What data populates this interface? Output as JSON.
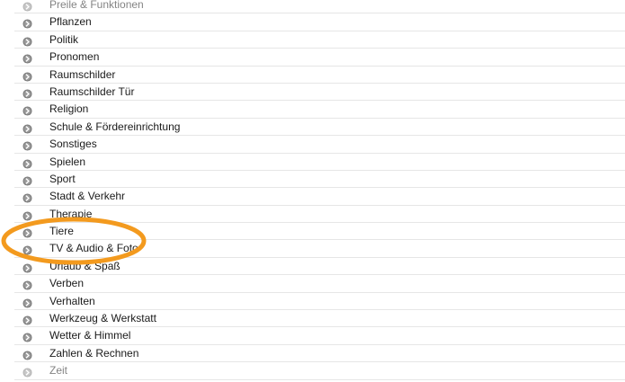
{
  "category_list": {
    "items": [
      {
        "label": "Preile & Funktionen"
      },
      {
        "label": "Pflanzen"
      },
      {
        "label": "Politik"
      },
      {
        "label": "Pronomen"
      },
      {
        "label": "Raumschilder"
      },
      {
        "label": "Raumschilder Tür"
      },
      {
        "label": "Religion"
      },
      {
        "label": "Schule & Fördereinrichtung"
      },
      {
        "label": "Sonstiges"
      },
      {
        "label": "Spielen"
      },
      {
        "label": "Sport"
      },
      {
        "label": "Stadt & Verkehr"
      },
      {
        "label": "Therapie"
      },
      {
        "label": "Tiere"
      },
      {
        "label": "TV & Audio & Foto"
      },
      {
        "label": "Urlaub & Spaß"
      },
      {
        "label": "Verben"
      },
      {
        "label": "Verhalten"
      },
      {
        "label": "Werkzeug & Werkstatt"
      },
      {
        "label": "Wetter & Himmel"
      },
      {
        "label": "Zahlen & Rechnen"
      },
      {
        "label": "Zeit"
      }
    ],
    "row_icon": "chevron-right-circle-icon",
    "highlighted_item": "Tiere"
  },
  "colors": {
    "highlight_ring": "#f39a1e",
    "icon_fill": "#7a7a7a",
    "divider": "#e6e6e6",
    "text": "#1a1a1a"
  }
}
